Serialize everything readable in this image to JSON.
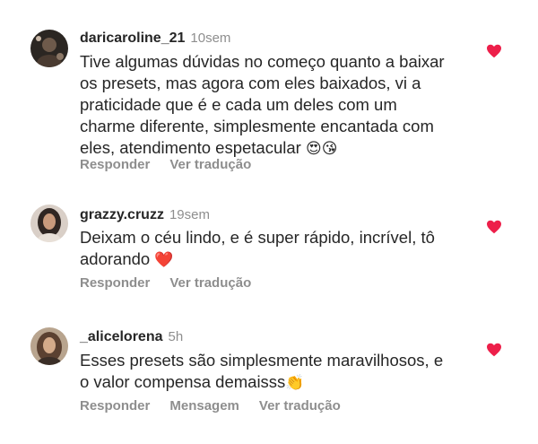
{
  "comments": [
    {
      "username": "daricaroline_21",
      "time": "10sem",
      "lines": [
        "Tive algumas dúvidas no começo quanto a baixar",
        "os presets, mas agora com eles baixados, vi a",
        "praticidade que é e cada um deles com um",
        "charme diferente, simplesmente encantada com",
        "eles, atendimento espetacular"
      ],
      "emoji": "😍😘",
      "actions": [
        "Responder",
        "Ver tradução"
      ],
      "liked": true
    },
    {
      "username": "grazzy.cruzz",
      "time": "19sem",
      "lines": [
        "Deixam o céu lindo, e é super rápido, incrível, tô",
        "adorando"
      ],
      "emoji": "❤️",
      "actions": [
        "Responder",
        "Ver tradução"
      ],
      "liked": true
    },
    {
      "username": "_alicelorena",
      "time": "5h",
      "lines": [
        "Esses presets são simplesmente maravilhosos, e",
        "o valor compensa demaisss"
      ],
      "emoji": "👏",
      "actions": [
        "Responder",
        "Mensagem",
        "Ver tradução"
      ],
      "liked": true
    }
  ],
  "colors": {
    "heart": "#ed1f4a",
    "muted": "#8e8e8e",
    "text": "#262626"
  },
  "icons": [
    "avatar",
    "heart-icon"
  ]
}
